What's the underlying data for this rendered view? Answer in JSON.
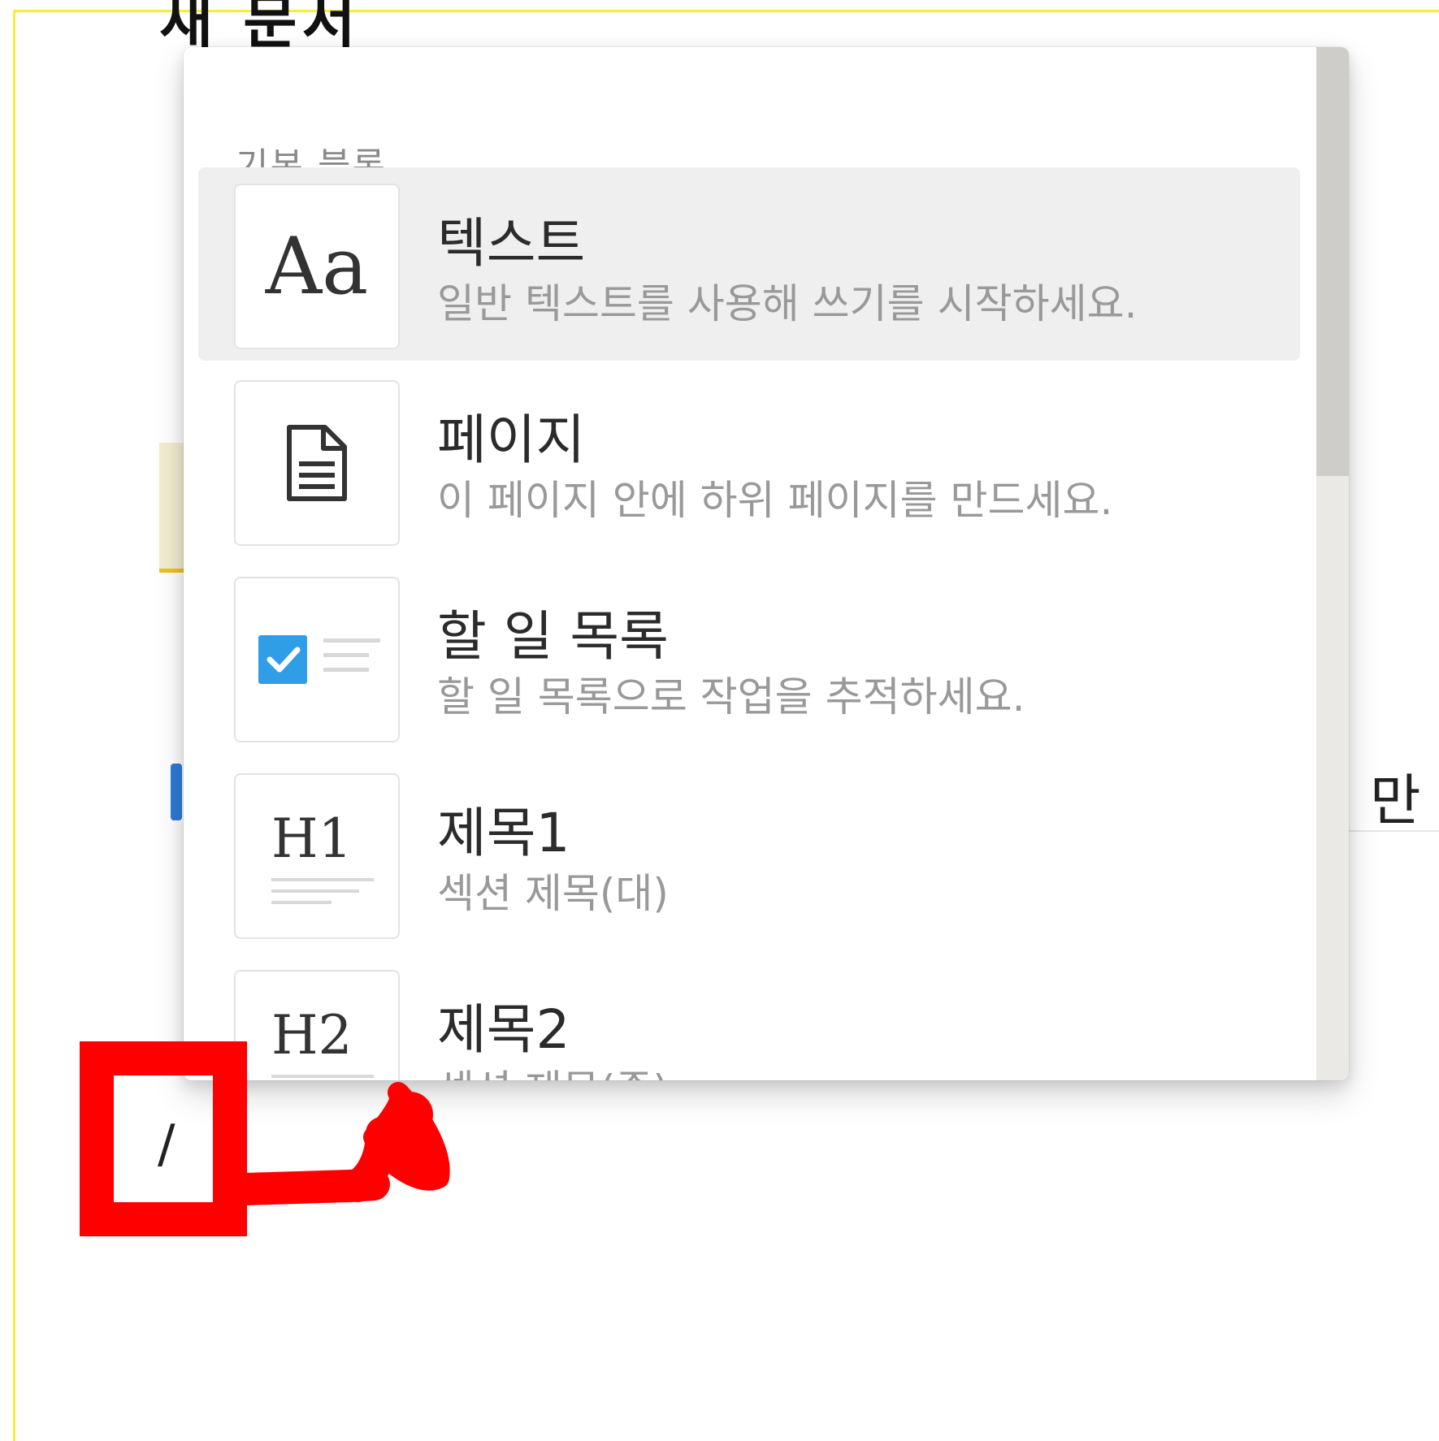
{
  "background": {
    "title_fragment": "새 문서",
    "right_fragment": "만"
  },
  "menu": {
    "section_label": "기본 블록",
    "items": [
      {
        "icon": "text-aa-icon",
        "thumb": "Aa",
        "title": "텍스트",
        "desc": "일반 텍스트를 사용해 쓰기를 시작하세요.",
        "selected": true
      },
      {
        "icon": "page-icon",
        "thumb": "",
        "title": "페이지",
        "desc": "이 페이지 안에 하위 페이지를 만드세요.",
        "selected": false
      },
      {
        "icon": "todo-checkbox-icon",
        "thumb": "",
        "title": "할 일 목록",
        "desc": "할 일 목록으로 작업을 추적하세요.",
        "selected": false
      },
      {
        "icon": "heading1-icon",
        "thumb": "H1",
        "title": "제목1",
        "desc": "섹션 제목(대)",
        "selected": false
      },
      {
        "icon": "heading2-icon",
        "thumb": "H2",
        "title": "제목2",
        "desc": "섹션 제목(중)",
        "selected": false
      }
    ]
  },
  "editor": {
    "typed_text": "/"
  },
  "colors": {
    "annotation": "#ff0000",
    "checkbox": "#2f9ee6",
    "selected_bg": "#efefef",
    "frame_border": "#f4ee3a"
  }
}
